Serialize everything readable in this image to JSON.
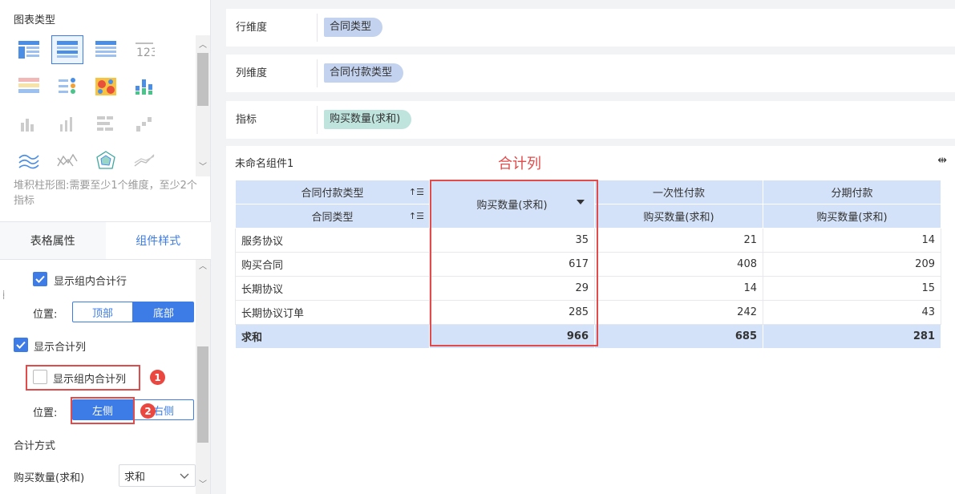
{
  "left": {
    "chart_type_title": "图表类型",
    "chart_types": [
      {
        "icon": "cross-table-icon",
        "selected": false
      },
      {
        "icon": "group-table-icon",
        "selected": true
      },
      {
        "icon": "detail-table-icon",
        "selected": false
      },
      {
        "icon": "kpi-number-icon",
        "label": "123",
        "selected": false
      },
      {
        "icon": "color-table-icon",
        "selected": false
      },
      {
        "icon": "dot-table-icon",
        "selected": false
      },
      {
        "icon": "heatmap-icon",
        "selected": false
      },
      {
        "icon": "stacked-bar-icon",
        "selected": false
      },
      {
        "icon": "column-chart-icon",
        "selected": false
      },
      {
        "icon": "grouped-column-icon",
        "selected": false
      },
      {
        "icon": "bar-chart-icon",
        "selected": false
      },
      {
        "icon": "waterfall-icon",
        "selected": false
      },
      {
        "icon": "line-chart-icon",
        "selected": false
      },
      {
        "icon": "area-chart-icon",
        "selected": false
      },
      {
        "icon": "radar-icon",
        "selected": false
      },
      {
        "icon": "multi-line-icon",
        "selected": false
      }
    ],
    "hint": "堆积柱形图:需要至少1个维度，至少2个指标",
    "tabs": [
      {
        "label": "表格属性",
        "active": false
      },
      {
        "label": "组件样式",
        "active": true
      }
    ],
    "show_group_subtotal_row": {
      "label": "显示组内合计行",
      "checked": true
    },
    "position_label_1": "位置:",
    "position_1": {
      "top": "顶部",
      "bottom": "底部",
      "selected": "底部"
    },
    "show_total_col": {
      "label": "显示合计列",
      "checked": true
    },
    "show_group_subtotal_col": {
      "label": "显示组内合计列",
      "checked": false
    },
    "position_label_2": "位置:",
    "position_2": {
      "left": "左侧",
      "right": "右侧",
      "selected": "左侧"
    },
    "badge_1": "1",
    "badge_2": "2",
    "total_method_title": "合计方式",
    "total_method_field": "购买数量(求和)",
    "total_method_value": "求和"
  },
  "right": {
    "row_dim": {
      "label": "行维度",
      "field": "合同类型"
    },
    "col_dim": {
      "label": "列维度",
      "field": "合同付款类型"
    },
    "measure": {
      "label": "指标",
      "field": "购买数量(求和)"
    },
    "component": {
      "title": "未命名组件1",
      "annotation": "合计列",
      "expand_icon": "expand-width-icon",
      "header": {
        "col_dim_label": "合同付款类型",
        "row_dim_label": "合同类型",
        "total_col_label": "购买数量(求和)",
        "col_groups": [
          "一次性付款",
          "分期付款"
        ],
        "measure_labels": [
          "购买数量(求和)",
          "购买数量(求和)"
        ]
      },
      "rows": [
        {
          "name": "服务协议",
          "total": "35",
          "one_time": "21",
          "installment": "14"
        },
        {
          "name": "购买合同",
          "total": "617",
          "one_time": "408",
          "installment": "209"
        },
        {
          "name": "长期协议",
          "total": "29",
          "one_time": "14",
          "installment": "15"
        },
        {
          "name": "长期协议订单",
          "total": "285",
          "one_time": "242",
          "installment": "43"
        }
      ],
      "total_row": {
        "name": "求和",
        "total": "966",
        "one_time": "685",
        "installment": "281"
      }
    }
  },
  "colors": {
    "accent": "#3d7ce6",
    "annotation_red": "#e04b4b",
    "header_bg": "#d3e2f8"
  }
}
